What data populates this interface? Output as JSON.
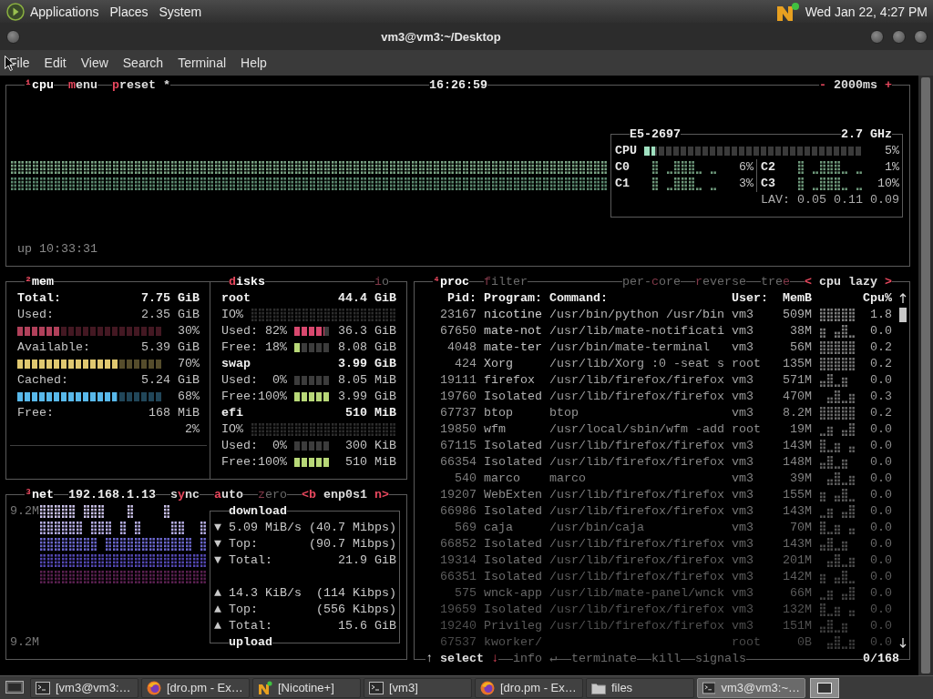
{
  "top_panel": {
    "menus": [
      "Applications",
      "Places",
      "System"
    ],
    "clock": "Wed Jan 22, 4:27 PM"
  },
  "window": {
    "title": "vm3@vm3:~/Desktop",
    "menu": [
      "File",
      "Edit",
      "View",
      "Search",
      "Terminal",
      "Help"
    ]
  },
  "btop": {
    "cpu": {
      "header": {
        "left": [
          {
            "kind": "title",
            "active": true,
            "segments": [
              {
                "text": "¹",
                "kind": "key"
              },
              {
                "text": "cpu",
                "kind": "plain"
              }
            ]
          },
          {
            "kind": "toggle",
            "active": true,
            "segments": [
              {
                "text": "m",
                "kind": "key"
              },
              {
                "text": "enu",
                "kind": "plain"
              }
            ]
          },
          {
            "kind": "toggle",
            "active": true,
            "segments": [
              {
                "text": "p",
                "kind": "key"
              },
              {
                "text": "reset *",
                "kind": "plain"
              }
            ]
          }
        ],
        "center": [
          {
            "kind": "text",
            "active": true,
            "segments": [
              {
                "text": "16:26:59",
                "kind": "plain"
              }
            ]
          }
        ],
        "right": [
          {
            "kind": "toggle",
            "active": true,
            "segments": [
              {
                "text": "-",
                "kind": "key"
              },
              {
                "text": " 2000ms ",
                "kind": "plain"
              },
              {
                "text": "+",
                "kind": "key"
              }
            ]
          }
        ]
      },
      "uptime": "up 10:33:31",
      "model": "E5-2697",
      "frequency": "2.7 GHz",
      "total": {
        "label": "CPU",
        "level": 0.05,
        "percent": "5%"
      },
      "cores": [
        {
          "label": "C0",
          "percent": "6%"
        },
        {
          "label": "C1",
          "percent": "3%"
        },
        {
          "label": "C2",
          "percent": "1%"
        },
        {
          "label": "C3",
          "percent": "10%"
        }
      ],
      "load": "LAV: 0.05 0.11 0.09"
    },
    "mem": {
      "header": {
        "left": [
          {
            "kind": "title",
            "active": true,
            "segments": [
              {
                "text": "²",
                "kind": "key"
              },
              {
                "text": "mem",
                "kind": "plain"
              }
            ]
          },
          {
            "kind": "title",
            "active": true,
            "segments": [
              {
                "text": "d",
                "kind": "key"
              },
              {
                "text": "isks",
                "kind": "plain"
              }
            ]
          }
        ],
        "right": [
          {
            "kind": "toggle",
            "active": false,
            "segments": [
              {
                "text": "i",
                "kind": "key"
              },
              {
                "text": "o",
                "kind": "plain"
              }
            ]
          }
        ]
      },
      "rows": [
        {
          "kind": "total",
          "label": "Total:",
          "value": "7.75 GiB"
        },
        {
          "kind": "stat",
          "label": "Used:",
          "value": "2.35 GiB"
        },
        {
          "kind": "meter",
          "color": "#b0405a",
          "level": 0.3,
          "percent": "30%"
        },
        {
          "kind": "stat",
          "label": "Available:",
          "value": "5.39 GiB"
        },
        {
          "kind": "meter",
          "color": "#e0c870",
          "level": 0.7,
          "percent": "70%"
        },
        {
          "kind": "stat",
          "label": "Cached:",
          "value": "5.24 GiB"
        },
        {
          "kind": "meter",
          "color": "#58b8ea",
          "level": 0.68,
          "percent": "68%"
        },
        {
          "kind": "stat",
          "label": "Free:",
          "value": "168 MiB"
        },
        {
          "kind": "percent",
          "percent": "2%"
        }
      ],
      "disks": [
        {
          "name": "root",
          "size": "44.4 GiB",
          "rows": [
            {
              "kind": "io",
              "label": "IO%"
            },
            {
              "kind": "meter",
              "label": "Used:",
              "percent": "82%",
              "level": 0.82,
              "color": "#d8486e",
              "value": "36.3 GiB"
            },
            {
              "kind": "meter",
              "label": "Free:",
              "percent": "18%",
              "level": 0.18,
              "color": "#b8d878",
              "value": "8.08 GiB"
            }
          ]
        },
        {
          "name": "swap",
          "size": "3.99 GiB",
          "rows": [
            {
              "kind": "meter",
              "label": "Used:",
              "percent": "0%",
              "value": "8.05 MiB"
            },
            {
              "kind": "meter",
              "label": "Free:",
              "percent": "100%",
              "level": 1,
              "color": "#b8d878",
              "value": "3.99 GiB"
            }
          ]
        },
        {
          "name": "efi",
          "size": "510 MiB",
          "rows": [
            {
              "kind": "io",
              "label": "IO%"
            },
            {
              "kind": "meter",
              "label": "Used:",
              "percent": "0%",
              "value": "300 KiB"
            },
            {
              "kind": "meter",
              "label": "Free:",
              "percent": "100%",
              "level": 1,
              "color": "#b8d878",
              "value": "510 MiB"
            }
          ]
        }
      ]
    },
    "net": {
      "header": {
        "left": [
          {
            "kind": "title",
            "active": true,
            "segments": [
              {
                "text": "³",
                "kind": "key"
              },
              {
                "text": "net",
                "kind": "plain"
              }
            ]
          },
          {
            "kind": "text",
            "active": true,
            "segments": [
              {
                "text": "192.168.1.13",
                "kind": "plain"
              }
            ]
          },
          {
            "kind": "toggle",
            "active": true,
            "segments": [
              {
                "text": "s",
                "kind": "plain"
              },
              {
                "text": "y",
                "kind": "key"
              },
              {
                "text": "nc",
                "kind": "plain"
              }
            ]
          },
          {
            "kind": "toggle",
            "active": true,
            "segments": [
              {
                "text": "a",
                "kind": "key"
              },
              {
                "text": "uto",
                "kind": "plain"
              }
            ]
          },
          {
            "kind": "toggle",
            "active": false,
            "segments": [
              {
                "text": "z",
                "kind": "key"
              },
              {
                "text": "ero",
                "kind": "plain"
              }
            ]
          },
          {
            "kind": "toggle",
            "active": true,
            "segments": [
              {
                "text": "<b",
                "kind": "key"
              },
              {
                "text": " enp0s1 ",
                "kind": "plain"
              },
              {
                "text": "n>",
                "kind": "key"
              }
            ]
          }
        ]
      },
      "graph_top": "9.2M",
      "graph_bottom": "9.2M",
      "download": {
        "title": "download",
        "rows": [
          {
            "arrow": "▼",
            "label": "5.09 MiB/s",
            "value": "(40.7 Mibps)"
          },
          {
            "arrow": "▼",
            "label": "Top:",
            "value": "(90.7 Mibps)"
          },
          {
            "arrow": "▼",
            "label": "Total:",
            "value": "21.9 GiB"
          }
        ]
      },
      "upload": {
        "title": "upload",
        "rows": [
          {
            "arrow": "▲",
            "label": "14.3 KiB/s",
            "value": "(114 Kibps)"
          },
          {
            "arrow": "▲",
            "label": "Top:",
            "value": "(556 Kibps)"
          },
          {
            "arrow": "▲",
            "label": "Total:",
            "value": "15.6 GiB"
          }
        ]
      }
    },
    "proc": {
      "header": {
        "left": [
          {
            "kind": "title",
            "active": true,
            "segments": [
              {
                "text": "⁴",
                "kind": "key"
              },
              {
                "text": "proc",
                "kind": "plain"
              }
            ]
          },
          {
            "kind": "toggle",
            "active": false,
            "segments": [
              {
                "text": "f",
                "kind": "key"
              },
              {
                "text": "ilter",
                "kind": "plain"
              }
            ]
          }
        ],
        "right": [
          {
            "kind": "toggle",
            "active": false,
            "segments": [
              {
                "text": "per-",
                "kind": "plain"
              },
              {
                "text": "c",
                "kind": "key"
              },
              {
                "text": "ore",
                "kind": "plain"
              }
            ]
          },
          {
            "kind": "toggle",
            "active": false,
            "segments": [
              {
                "text": "r",
                "kind": "key"
              },
              {
                "text": "everse",
                "kind": "plain"
              }
            ]
          },
          {
            "kind": "toggle",
            "active": false,
            "segments": [
              {
                "text": "tre",
                "kind": "plain"
              },
              {
                "text": "e",
                "kind": "key"
              }
            ]
          },
          {
            "kind": "toggle",
            "active": true,
            "segments": [
              {
                "text": "<",
                "kind": "key"
              },
              {
                "text": " cpu lazy ",
                "kind": "plain"
              },
              {
                "text": ">",
                "kind": "key"
              }
            ]
          }
        ]
      },
      "columns": [
        "Pid:",
        "Program:",
        "Command:",
        "User:",
        "MemB",
        "Cpu%"
      ],
      "rows": [
        {
          "pid": "23167",
          "program": "nicotine",
          "command": "/usr/bin/python /usr/bin",
          "user": "vm3",
          "mem": "509M",
          "cpu": "1.8"
        },
        {
          "pid": "67650",
          "program": "mate-not",
          "command": "/usr/lib/mate-notificati",
          "user": "vm3",
          "mem": "38M",
          "cpu": "0.0"
        },
        {
          "pid": "4048",
          "program": "mate-ter",
          "command": "/usr/bin/mate-terminal",
          "user": "vm3",
          "mem": "56M",
          "cpu": "0.2"
        },
        {
          "pid": "424",
          "program": "Xorg",
          "command": "/usr/lib/Xorg :0 -seat s",
          "user": "root",
          "mem": "135M",
          "cpu": "0.2"
        },
        {
          "pid": "19111",
          "program": "firefox",
          "command": "/usr/lib/firefox/firefox",
          "user": "vm3",
          "mem": "571M",
          "cpu": "0.0"
        },
        {
          "pid": "19760",
          "program": "Isolated",
          "command": "/usr/lib/firefox/firefox",
          "user": "vm3",
          "mem": "470M",
          "cpu": "0.3"
        },
        {
          "pid": "67737",
          "program": "btop",
          "command": "btop",
          "user": "vm3",
          "mem": "8.2M",
          "cpu": "0.2"
        },
        {
          "pid": "19850",
          "program": "wfm",
          "command": "/usr/local/sbin/wfm -add",
          "user": "root",
          "mem": "19M",
          "cpu": "0.0"
        },
        {
          "pid": "67115",
          "program": "Isolated",
          "command": "/usr/lib/firefox/firefox",
          "user": "vm3",
          "mem": "143M",
          "cpu": "0.0"
        },
        {
          "pid": "66354",
          "program": "Isolated",
          "command": "/usr/lib/firefox/firefox",
          "user": "vm3",
          "mem": "148M",
          "cpu": "0.0"
        },
        {
          "pid": "540",
          "program": "marco",
          "command": "marco",
          "user": "vm3",
          "mem": "39M",
          "cpu": "0.0"
        },
        {
          "pid": "19207",
          "program": "WebExten",
          "command": "/usr/lib/firefox/firefox",
          "user": "vm3",
          "mem": "155M",
          "cpu": "0.0"
        },
        {
          "pid": "66986",
          "program": "Isolated",
          "command": "/usr/lib/firefox/firefox",
          "user": "vm3",
          "mem": "143M",
          "cpu": "0.0"
        },
        {
          "pid": "569",
          "program": "caja",
          "command": "/usr/bin/caja",
          "user": "vm3",
          "mem": "70M",
          "cpu": "0.0"
        },
        {
          "pid": "66852",
          "program": "Isolated",
          "command": "/usr/lib/firefox/firefox",
          "user": "vm3",
          "mem": "143M",
          "cpu": "0.0"
        },
        {
          "pid": "19314",
          "program": "Isolated",
          "command": "/usr/lib/firefox/firefox",
          "user": "vm3",
          "mem": "201M",
          "cpu": "0.0"
        },
        {
          "pid": "66351",
          "program": "Isolated",
          "command": "/usr/lib/firefox/firefox",
          "user": "vm3",
          "mem": "142M",
          "cpu": "0.0"
        },
        {
          "pid": "575",
          "program": "wnck-app",
          "command": "/usr/lib/mate-panel/wnck",
          "user": "vm3",
          "mem": "66M",
          "cpu": "0.0"
        },
        {
          "pid": "19659",
          "program": "Isolated",
          "command": "/usr/lib/firefox/firefox",
          "user": "vm3",
          "mem": "132M",
          "cpu": "0.0"
        },
        {
          "pid": "19240",
          "program": "Privileg",
          "command": "/usr/lib/firefox/firefox",
          "user": "vm3",
          "mem": "151M",
          "cpu": "0.0"
        },
        {
          "pid": "67537",
          "program": "kworker/",
          "user": "root",
          "mem": "0B",
          "cpu": "0.0"
        }
      ],
      "footer": {
        "left": [
          {
            "kind": "toggle",
            "active": true,
            "segments": [
              {
                "text": "↑",
                "kind": "plain"
              },
              {
                "text": " select ",
                "kind": "plain"
              },
              {
                "text": "↓",
                "kind": "key"
              }
            ]
          },
          {
            "kind": "toggle",
            "active": false,
            "segments": [
              {
                "text": "info ",
                "kind": "plain"
              },
              {
                "text": "↵",
                "kind": "plain"
              }
            ]
          },
          {
            "kind": "toggle",
            "active": false,
            "segments": [
              {
                "text": "terminate",
                "kind": "plain"
              }
            ]
          },
          {
            "kind": "toggle",
            "active": false,
            "segments": [
              {
                "text": "kill",
                "kind": "plain"
              }
            ]
          },
          {
            "kind": "toggle",
            "active": false,
            "segments": [
              {
                "text": "signals",
                "kind": "plain"
              }
            ]
          }
        ],
        "right": [
          {
            "kind": "text",
            "active": true,
            "segments": [
              {
                "text": "0/168",
                "kind": "plain"
              }
            ]
          }
        ]
      }
    }
  },
  "taskbar": {
    "items": [
      {
        "kind": "terminal",
        "label": "[vm3@vm3:…",
        "selected": false
      },
      {
        "kind": "firefox",
        "label": "[dro.pm - Ex…",
        "selected": false
      },
      {
        "kind": "nicotine",
        "label": "[Nicotine+]",
        "selected": false
      },
      {
        "kind": "terminal",
        "label": "[vm3]",
        "selected": false
      },
      {
        "kind": "firefox",
        "label": "[dro.pm - Ex…",
        "selected": false
      },
      {
        "kind": "folder",
        "label": "files",
        "selected": false
      },
      {
        "kind": "terminal",
        "label": "vm3@vm3:~…",
        "selected": true
      }
    ]
  }
}
